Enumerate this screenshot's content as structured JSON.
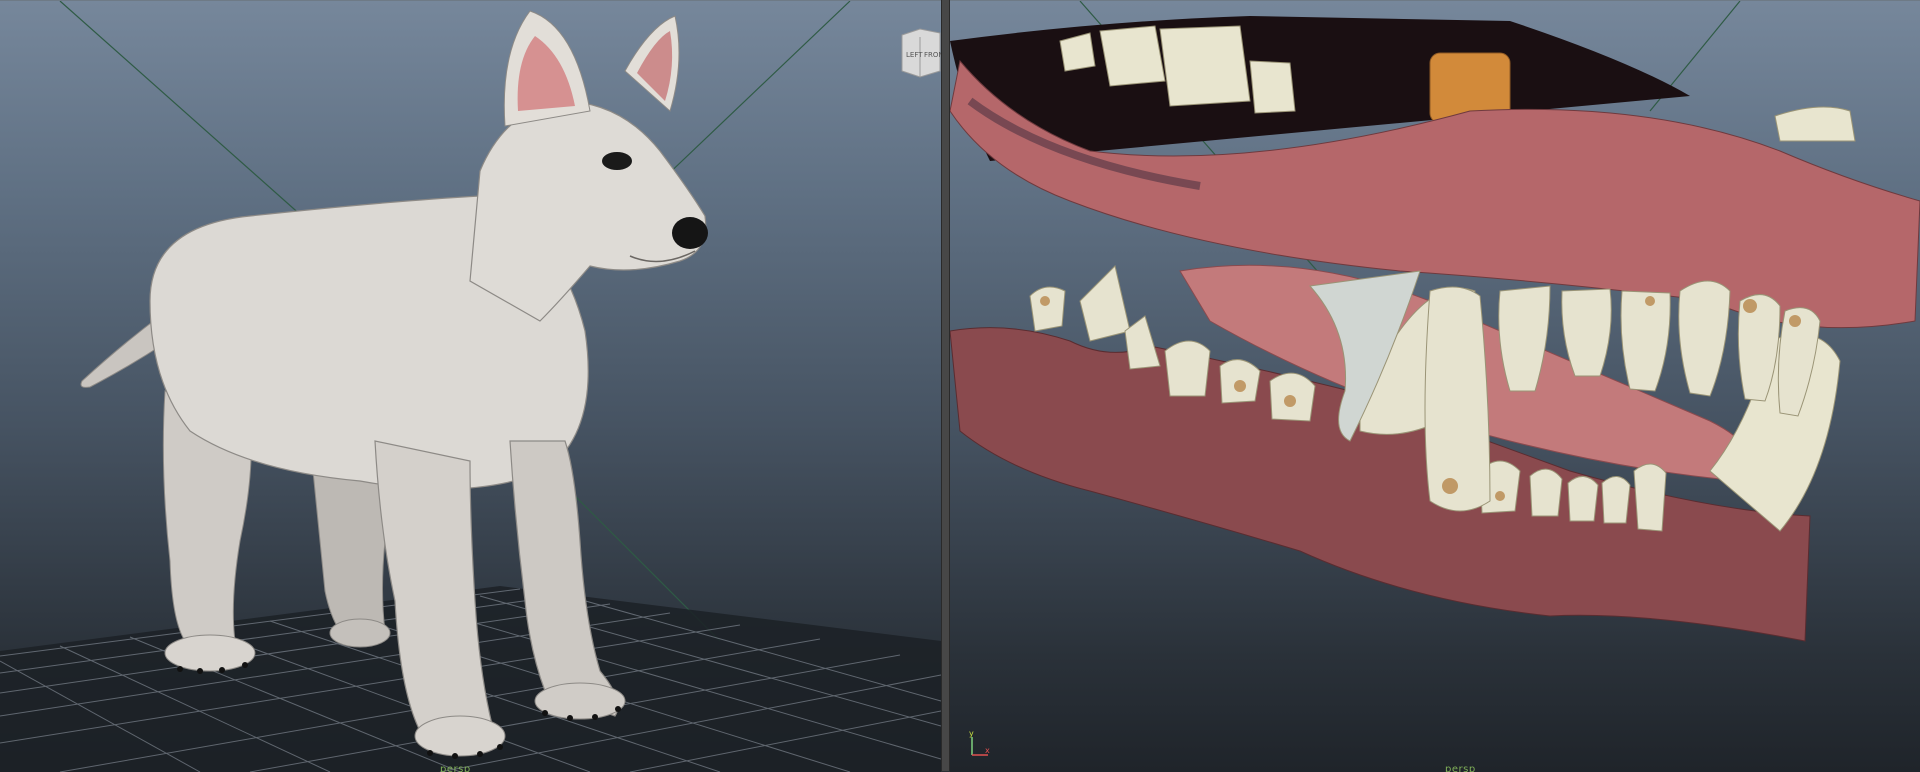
{
  "viewports": {
    "left": {
      "camera_label": "persp",
      "viewcube": {
        "faces": [
          "LEFT",
          "FRONT"
        ]
      }
    },
    "right": {
      "camera_label": "persp",
      "axis": {
        "y": "y",
        "x": "x"
      }
    }
  },
  "colors": {
    "background_top": "#76879b",
    "background_bottom": "#1f242a",
    "grid_line": "#6a717a",
    "axis_line": "#3f6e52",
    "camera_label": "#7fae58",
    "dog_fur": "#d9d6d1",
    "gum": "#b86a6a",
    "tooth": "#e6e3cf"
  }
}
